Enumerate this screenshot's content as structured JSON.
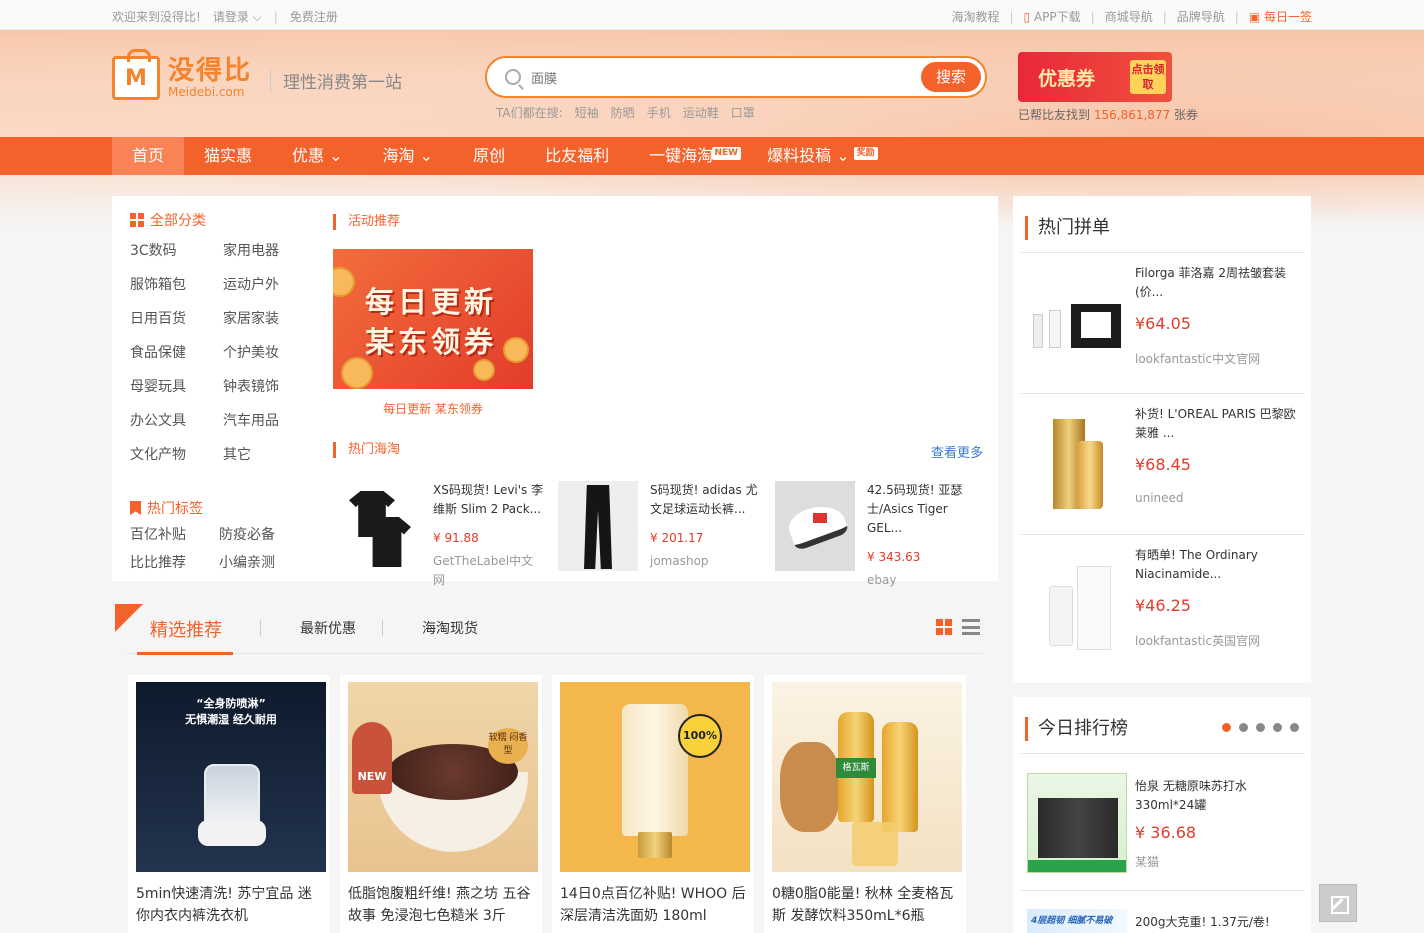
{
  "topbar": {
    "welcome": "欢迎来到没得比!",
    "login": "请登录",
    "register": "免费注册",
    "links": [
      "海淘教程",
      "APP下载",
      "商城导航",
      "品牌导航",
      "每日一签"
    ]
  },
  "logo": {
    "cn": "没得比",
    "en": "Meidebi.com",
    "mark": "M"
  },
  "slogan": "理性消费第一站",
  "search": {
    "placeholder": "面膜",
    "button": "搜索",
    "hot_label": "TA们都在搜:",
    "hot": [
      "短袖",
      "防晒",
      "手机",
      "运动鞋",
      "口罩"
    ]
  },
  "coupon": {
    "title": "优惠券",
    "badge": "点击领取",
    "prefix": "已帮比友找到",
    "count": "156,861,877",
    "suffix": "张券"
  },
  "nav": {
    "items": [
      "首页",
      "猫实惠",
      "优惠",
      "海淘",
      "原创",
      "比友福利",
      "一键海淘",
      "爆料投稿"
    ],
    "badge_new": "NEW",
    "badge_reward": "奖励"
  },
  "categories": {
    "title": "全部分类",
    "items": [
      "3C数码",
      "家用电器",
      "服饰箱包",
      "运动户外",
      "日用百货",
      "家居家装",
      "食品保健",
      "个护美妆",
      "母婴玩具",
      "钟表镜饰",
      "办公文具",
      "汽车用品",
      "文化产物",
      "其它"
    ],
    "tags_title": "热门标签",
    "tags": [
      "百亿补贴",
      "防疫必备",
      "比比推荐",
      "小编亲测"
    ]
  },
  "activity": {
    "title": "活动推荐",
    "banner_line1": "每日更新",
    "banner_line2": "某东领券",
    "caption": "每日更新 某东领券"
  },
  "haitao": {
    "title": "热门海淘",
    "more": "查看更多",
    "items": [
      {
        "title": "XS码现货! Levi's 李维斯 Slim 2 Pack...",
        "price": "¥ 91.88",
        "shop": "GetTheLabel中文网"
      },
      {
        "title": "S码现货! adidas 尤文足球运动长裤...",
        "price": "¥ 201.17",
        "shop": "jomashop"
      },
      {
        "title": "42.5码现货! 亚瑟士/Asics Tiger GEL...",
        "price": "¥ 343.63",
        "shop": "ebay"
      }
    ]
  },
  "featured": {
    "tabs": [
      "精选推荐",
      "最新优惠",
      "海淘现货"
    ],
    "cards": [
      {
        "title": "5min快速清洗! 苏宁宜品 迷你内衣内裤洗衣机",
        "img_text1": "“全身防喷淋”",
        "img_text2": "无惧潮湿 经久耐用"
      },
      {
        "title": "低脂饱腹粗纤维! 燕之坊 五谷故事 免浸泡七色糙米 3斤",
        "img_badge": "NEW",
        "img_tag": "软糯 闷香型"
      },
      {
        "title": "14日0点百亿补贴! WHOO 后 深层清洁洗面奶 180ml",
        "img_badge": "100%"
      },
      {
        "title": "0糖0脂0能量! 秋林 全麦格瓦斯 发酵饮料350mL*6瓶",
        "img_label": "格瓦斯"
      }
    ]
  },
  "hot_group": {
    "title": "热门拼单",
    "items": [
      {
        "title": "Filorga 菲洛嘉 2周祛皱套装 (价...",
        "price": "¥64.05",
        "shop": "lookfantastic中文官网"
      },
      {
        "title": "补货! L'OREAL PARIS 巴黎欧莱雅 ...",
        "price": "¥68.45",
        "shop": "unineed"
      },
      {
        "title": "有晒单! The Ordinary Niacinamide...",
        "price": "¥46.25",
        "shop": "lookfantastic英国官网"
      }
    ]
  },
  "ranking": {
    "title": "今日排行榜",
    "items": [
      {
        "title": "怡泉 无糖原味苏打水330ml*24罐",
        "price": "¥ 36.68",
        "shop": "某猫"
      },
      {
        "title": "200g大克重! 1.37元/卷!",
        "img_text": "4层超韧 细腻不易破"
      }
    ]
  },
  "colors": {
    "accent": "#f4622b",
    "price": "#e23c2a",
    "link": "#3a7bd5"
  }
}
